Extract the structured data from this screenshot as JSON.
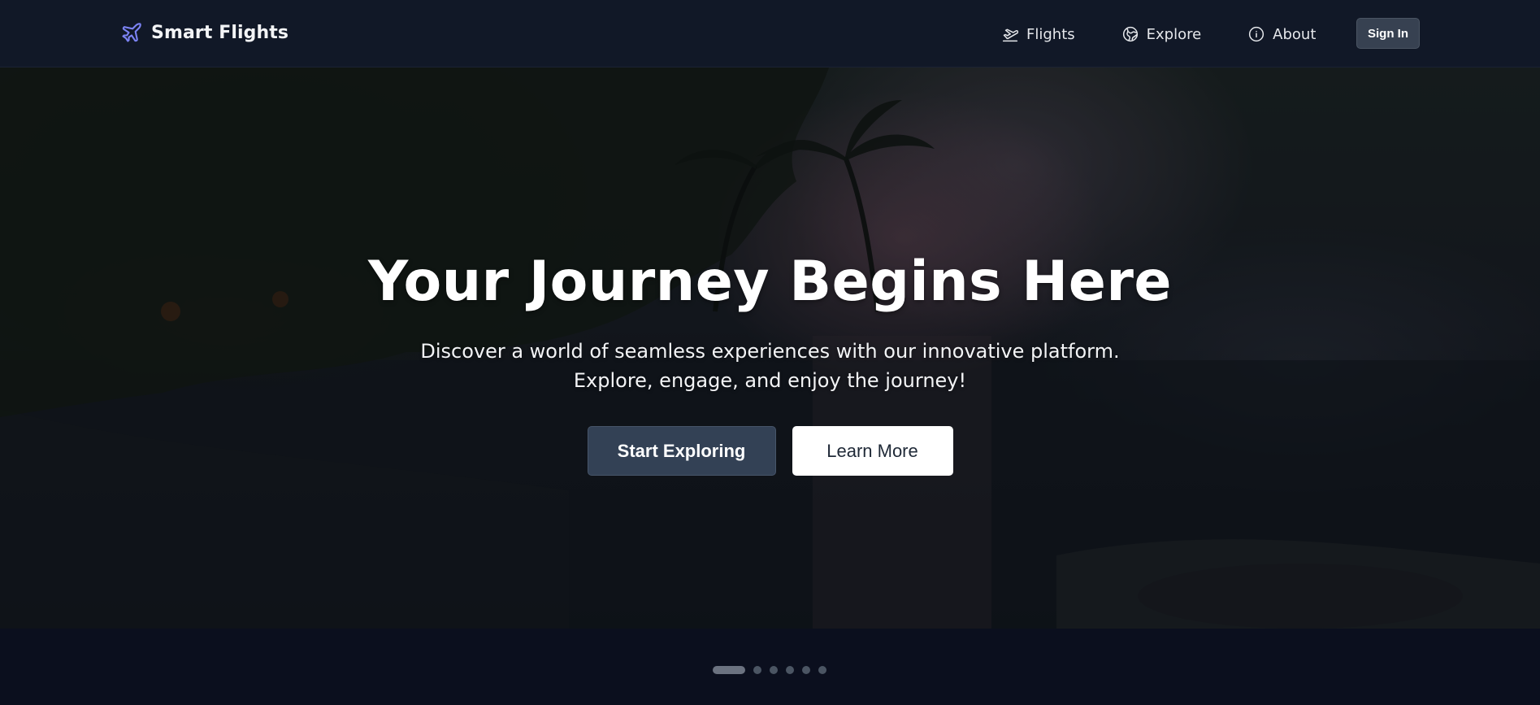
{
  "brand": {
    "name": "Smart Flights",
    "icon": "plane-icon",
    "accent_color": "#6366f1"
  },
  "nav": {
    "items": [
      {
        "label": "Flights",
        "icon": "flight-takeoff-icon"
      },
      {
        "label": "Explore",
        "icon": "globe-icon"
      },
      {
        "label": "About",
        "icon": "info-circle-icon"
      }
    ],
    "sign_in_label": "Sign In"
  },
  "hero": {
    "title": "Your Journey Begins Here",
    "subtitle": "Discover a world of seamless experiences with our innovative platform. Explore, engage, and enjoy the journey!",
    "primary_button": "Start Exploring",
    "secondary_button": "Learn More",
    "background": "tropical beach at dusk with palm trees"
  },
  "carousel": {
    "slide_count": 6,
    "active_index": 0
  },
  "colors": {
    "header_bg": "#111827",
    "page_bg": "#0b0f1e",
    "primary_button_bg": "#334155",
    "secondary_button_bg": "#ffffff",
    "dot_inactive": "#4b5563",
    "dot_active": "#6b7280"
  }
}
